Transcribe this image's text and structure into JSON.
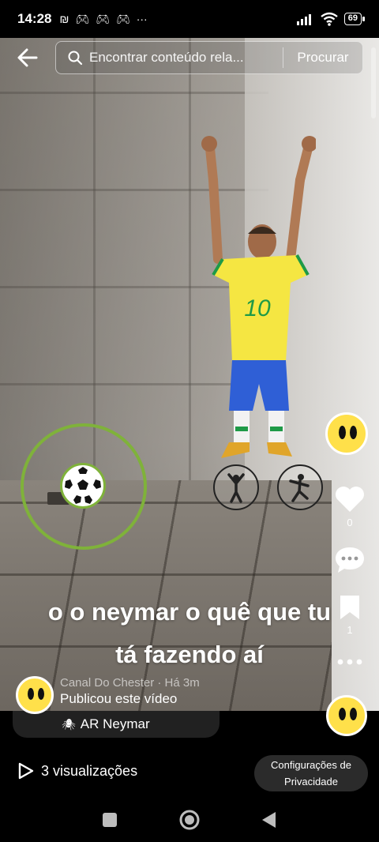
{
  "status_bar": {
    "time": "14:28",
    "extra": "···",
    "battery": "69"
  },
  "search": {
    "placeholder": "Encontrar conteúdo rela...",
    "button_label": "Procurar"
  },
  "video": {
    "caption_line1": "o o neymar o quê que tu",
    "caption_line2": "tá fazendo aí",
    "jersey_number": "10"
  },
  "actions": {
    "like_count": "0",
    "save_count": "1"
  },
  "creator": {
    "name_line": "Canal Do Chester · Há 3m",
    "published_label": "Publicou este vídeo",
    "effect_name": "AR Neymar"
  },
  "footer": {
    "views_label": "3 visualizações",
    "privacy_line1": "Configurações de",
    "privacy_line2": "Privacidade"
  },
  "colors": {
    "ring": "#7fb23a",
    "avatar": "#ffe04a",
    "jersey": "#f5e642",
    "shorts": "#2f5fd6"
  },
  "icons": {
    "back": "arrow-left-icon",
    "search": "search-icon",
    "like": "heart-icon",
    "comment": "comment-icon",
    "save": "bookmark-icon",
    "more": "more-dots-icon",
    "views": "play-icon"
  }
}
